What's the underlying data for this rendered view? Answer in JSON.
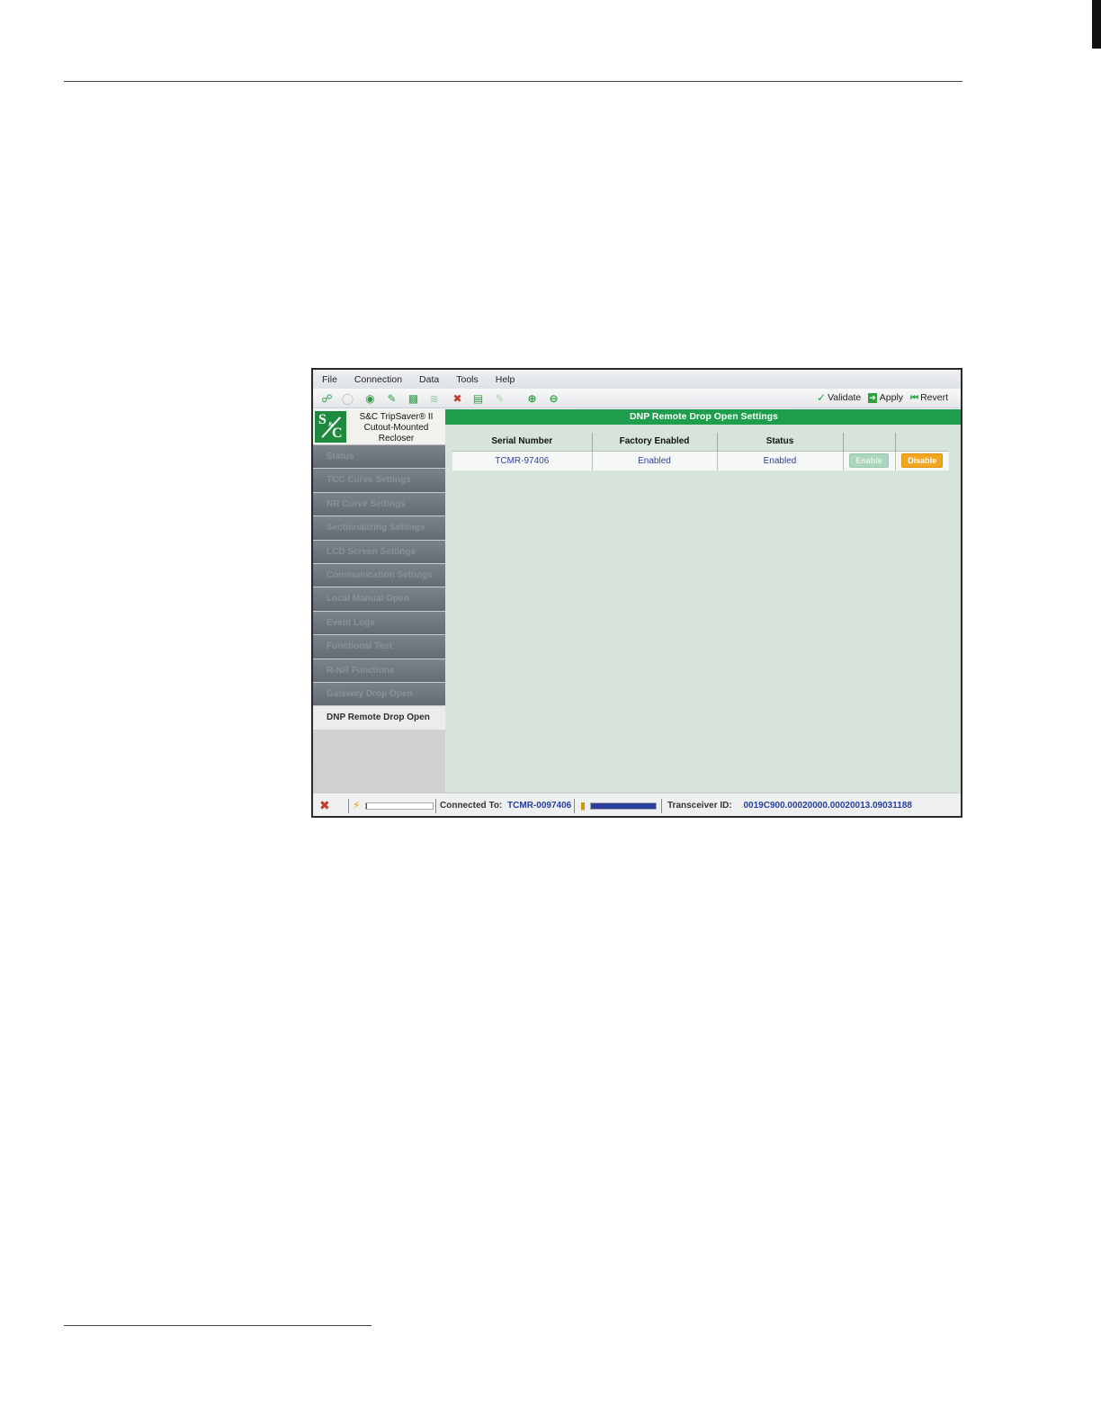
{
  "menu": [
    "File",
    "Connection",
    "Data",
    "Tools",
    "Help"
  ],
  "toolbar": {
    "actions": {
      "validate": "Validate",
      "apply": "Apply",
      "revert": "Revert"
    },
    "colors": {
      "validate": "#2e9e3f",
      "apply": "#2e9e3f",
      "revert": "#2e9e3f"
    }
  },
  "brand": {
    "line1": "S&C TripSaver® II",
    "line2": "Cutout-Mounted",
    "line3": "Recloser",
    "logo_s": "S",
    "logo_amp": "&",
    "logo_c": "C"
  },
  "nav": [
    "Status",
    "TCC Curve Settings",
    "NR Curve Settings",
    "Sectionalizing Settings",
    "LCD Screen Settings",
    "Communication Settings",
    "Local Manual Open",
    "Event Logs",
    "Functional Test",
    "R-NR Functions",
    "Gateway Drop Open",
    "DNP Remote Drop Open"
  ],
  "nav_active_index": 11,
  "panel": {
    "title": "DNP Remote Drop Open Settings",
    "columns": [
      "Serial Number",
      "Factory Enabled",
      "Status",
      "",
      ""
    ],
    "rows": [
      {
        "serial": "TCMR-97406",
        "factory_enabled": "Enabled",
        "status": "Enabled",
        "enable_label": "Enable",
        "disable_label": "Disable"
      }
    ]
  },
  "statusbar": {
    "connected_label": "Connected To:",
    "connected_value": "TCMR-0097406",
    "transceiver_label": "Transceiver ID:",
    "transceiver_value": "0019C900.00020000.00020013.09031188",
    "signal_level": 0.02,
    "battery_level": 1.0
  }
}
